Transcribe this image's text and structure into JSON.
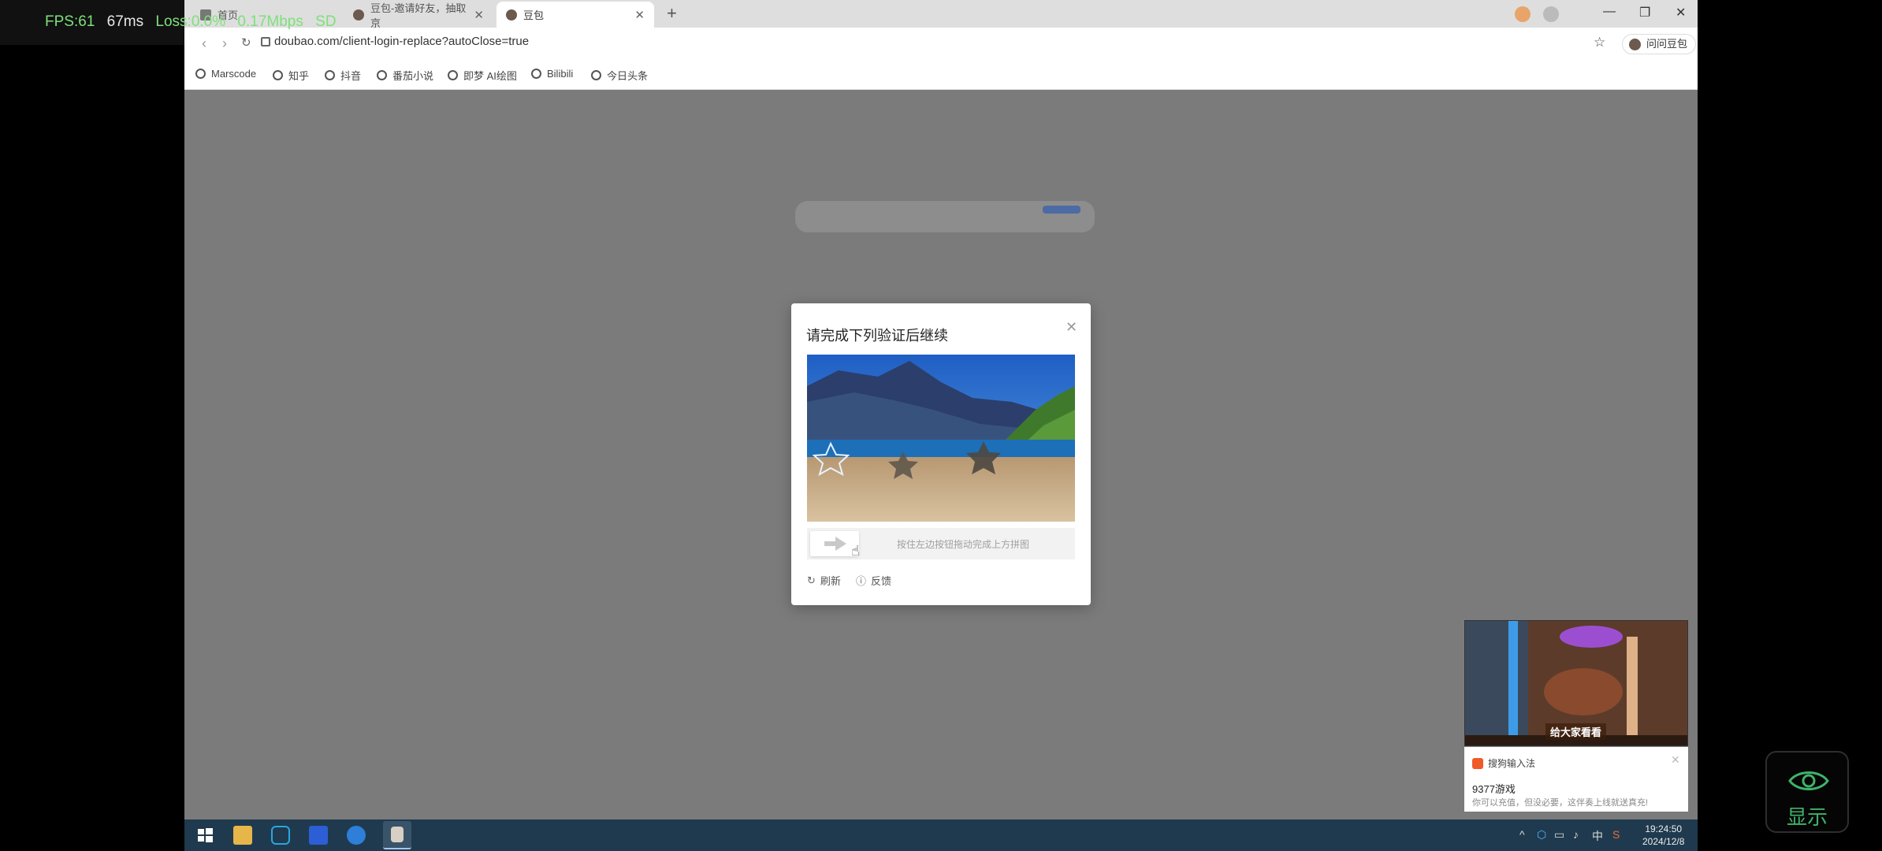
{
  "overlay_stats": {
    "fps": "FPS:61",
    "latency": "67ms",
    "loss": "Loss:0.0%",
    "bandwidth": "0.17Mbps",
    "quality": "SD"
  },
  "browser": {
    "tabs": [
      {
        "label": "首页",
        "active": false
      },
      {
        "label": "豆包-邀请好友，抽取京",
        "active": false
      },
      {
        "label": "豆包",
        "active": true
      }
    ],
    "url": "doubao.com/client-login-replace?autoClose=true",
    "profile_button": "问问豆包",
    "bookmarks": [
      "Marscode",
      "知乎",
      "抖音",
      "番茄小说",
      "即梦 AI绘图",
      "Bilibili",
      "今日头条"
    ]
  },
  "captcha": {
    "title": "请完成下列验证后继续",
    "slider_hint": "按住左边按钮拖动完成上方拼图",
    "refresh_label": "刷新",
    "feedback_label": "反馈",
    "colors": {
      "sky": "#2e6fd0",
      "lake": "#1e73b8",
      "ground": "#c8ab84"
    }
  },
  "taskbar": {
    "clock_time": "19:24:50",
    "clock_date": "2024/12/8",
    "ime_indicator": "中",
    "icons": [
      "windows-start-icon",
      "file-explorer-icon",
      "box-app-icon",
      "media-app-icon",
      "browser-s-icon",
      "doubao-app-icon"
    ]
  },
  "game_preview": {
    "label": "给大家看看"
  },
  "ime_popup": {
    "app_name": "搜狗输入法",
    "title": "9377游戏",
    "subtitle": "你可以充值，但没必要，这伴奏上线就送真充!"
  },
  "show_button": {
    "label": "显示",
    "color": "#3fb36a"
  }
}
